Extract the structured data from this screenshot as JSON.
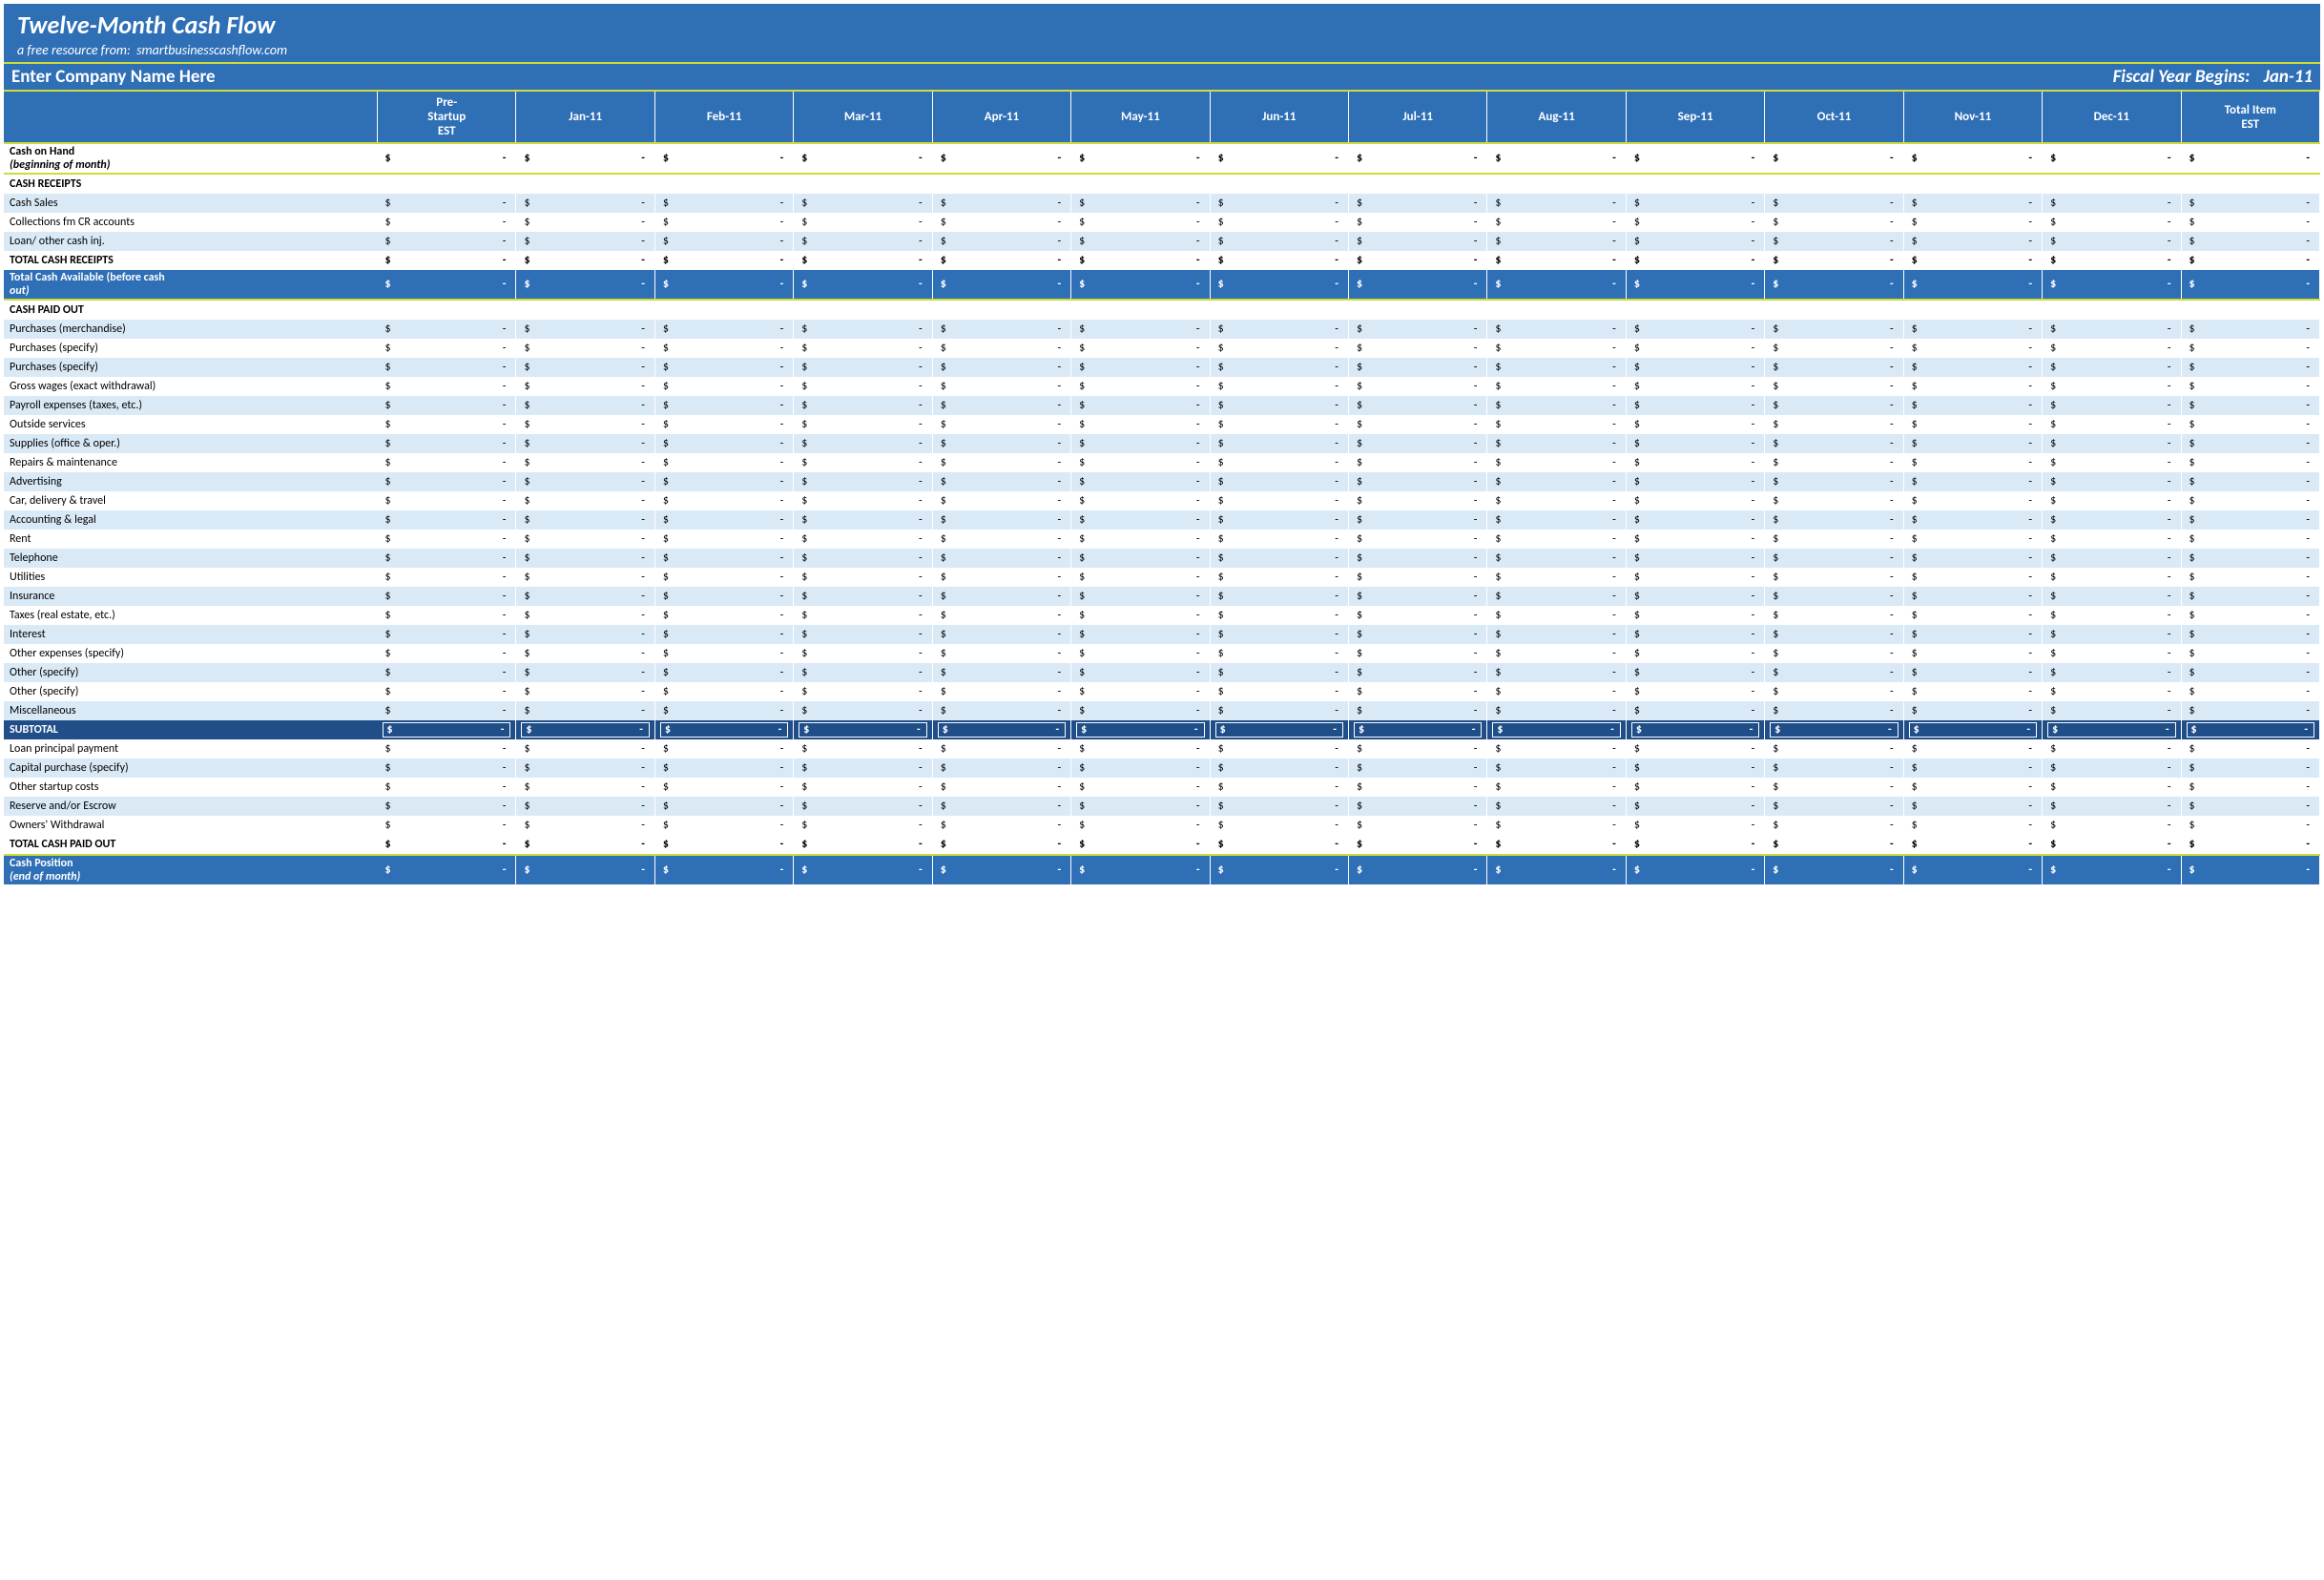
{
  "header": {
    "title": "Twelve-Month Cash Flow",
    "subtitle_prefix": "a free resource from:",
    "subtitle_link": "smartbusinesscashflow.com"
  },
  "company": {
    "name_placeholder": "Enter Company Name Here",
    "fy_label": "Fiscal Year Begins:",
    "fy_value": "Jan-11"
  },
  "columns": [
    "",
    "Pre-Startup EST",
    "Jan-11",
    "Feb-11",
    "Mar-11",
    "Apr-11",
    "May-11",
    "Jun-11",
    "Jul-11",
    "Aug-11",
    "Sep-11",
    "Oct-11",
    "Nov-11",
    "Dec-11",
    "Total Item EST"
  ],
  "currency": "$",
  "dash": "-",
  "rows": [
    {
      "label": "Cash on Hand (beginning of month)",
      "style": "coh",
      "label_plain": "Cash on Hand",
      "label_sub": "(beginning of month)"
    },
    {
      "label": "CASH RECEIPTS",
      "style": "section",
      "novals": true
    },
    {
      "label": "Cash Sales",
      "style": "light"
    },
    {
      "label": "Collections fm CR accounts",
      "style": "white"
    },
    {
      "label": "Loan/ other cash inj.",
      "style": "light"
    },
    {
      "label": "TOTAL CASH RECEIPTS",
      "style": "white bold"
    },
    {
      "label": "Total Cash Available (before cash out)",
      "style": "tca",
      "label_plain": "Total Cash Available (before cash",
      "label_sub": "out)"
    },
    {
      "label": "CASH PAID OUT",
      "style": "section",
      "novals": true
    },
    {
      "label": "Purchases (merchandise)",
      "style": "light"
    },
    {
      "label": "Purchases (specify)",
      "style": "white"
    },
    {
      "label": "Purchases (specify)",
      "style": "light"
    },
    {
      "label": "Gross wages (exact withdrawal)",
      "style": "white"
    },
    {
      "label": "Payroll expenses (taxes, etc.)",
      "style": "light"
    },
    {
      "label": "Outside services",
      "style": "white"
    },
    {
      "label": "Supplies (office & oper.)",
      "style": "light"
    },
    {
      "label": "Repairs & maintenance",
      "style": "white"
    },
    {
      "label": "Advertising",
      "style": "light"
    },
    {
      "label": "Car, delivery & travel",
      "style": "white"
    },
    {
      "label": "Accounting & legal",
      "style": "light"
    },
    {
      "label": "Rent",
      "style": "white"
    },
    {
      "label": "Telephone",
      "style": "light"
    },
    {
      "label": "Utilities",
      "style": "white"
    },
    {
      "label": "Insurance",
      "style": "light"
    },
    {
      "label": "Taxes (real estate, etc.)",
      "style": "white"
    },
    {
      "label": "Interest",
      "style": "light"
    },
    {
      "label": "Other expenses (specify)",
      "style": "white"
    },
    {
      "label": "Other (specify)",
      "style": "light"
    },
    {
      "label": "Other (specify)",
      "style": "white"
    },
    {
      "label": "Miscellaneous",
      "style": "light"
    },
    {
      "label": "SUBTOTAL",
      "style": "sub"
    },
    {
      "label": "Loan principal payment",
      "style": "white"
    },
    {
      "label": "Capital purchase (specify)",
      "style": "light"
    },
    {
      "label": "Other startup costs",
      "style": "white"
    },
    {
      "label": "Reserve and/or Escrow",
      "style": "light"
    },
    {
      "label": "Owners' Withdrawal",
      "style": "white"
    },
    {
      "label": "TOTAL CASH PAID OUT",
      "style": "white bold ybtm"
    },
    {
      "label": "Cash Position (end of month)",
      "style": "tca",
      "label_plain": "Cash Position",
      "label_sub": "(end of month)"
    }
  ]
}
